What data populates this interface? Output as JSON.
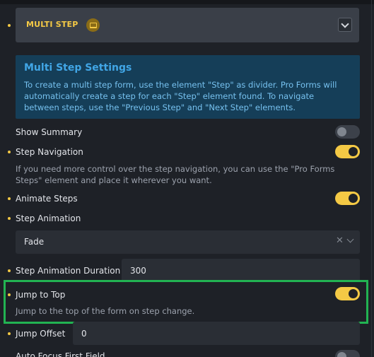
{
  "section": {
    "title": "MULTI STEP",
    "badge_icon": "laptop-icon",
    "collapse_icon": "chevron-down-icon"
  },
  "info": {
    "title": "Multi Step Settings",
    "text": "To create a multi step form, use the element \"Step\" as divider. Pro Forms will automatically create a step for each \"Step\" element found. To navigate between steps, use the \"Previous Step\" and \"Next Step\" elements."
  },
  "controls": {
    "show_summary": {
      "label": "Show Summary",
      "enabled": false
    },
    "step_navigation": {
      "label": "Step Navigation",
      "enabled": true,
      "description": "If you need more control over the step navigation, you can use the \"Pro Forms Steps\" element and place it wherever you want."
    },
    "animate_steps": {
      "label": "Animate Steps",
      "enabled": true
    },
    "step_animation": {
      "label": "Step Animation",
      "value": "Fade",
      "clear_icon": "close-icon",
      "dropdown_icon": "chevron-down-icon"
    },
    "step_animation_duration": {
      "label": "Step Animation Duration",
      "value": "300"
    },
    "jump_to_top": {
      "label": "Jump to Top",
      "enabled": true,
      "description": "Jump to the top of the form on step change."
    },
    "jump_offset": {
      "label": "Jump Offset",
      "value": "0"
    },
    "auto_focus_first_field": {
      "label": "Auto Focus First Field",
      "enabled": false
    }
  },
  "colors": {
    "accent": "#f4c945",
    "highlight": "#22b352",
    "info_background": "#153e58",
    "info_title": "#41a6e6"
  }
}
